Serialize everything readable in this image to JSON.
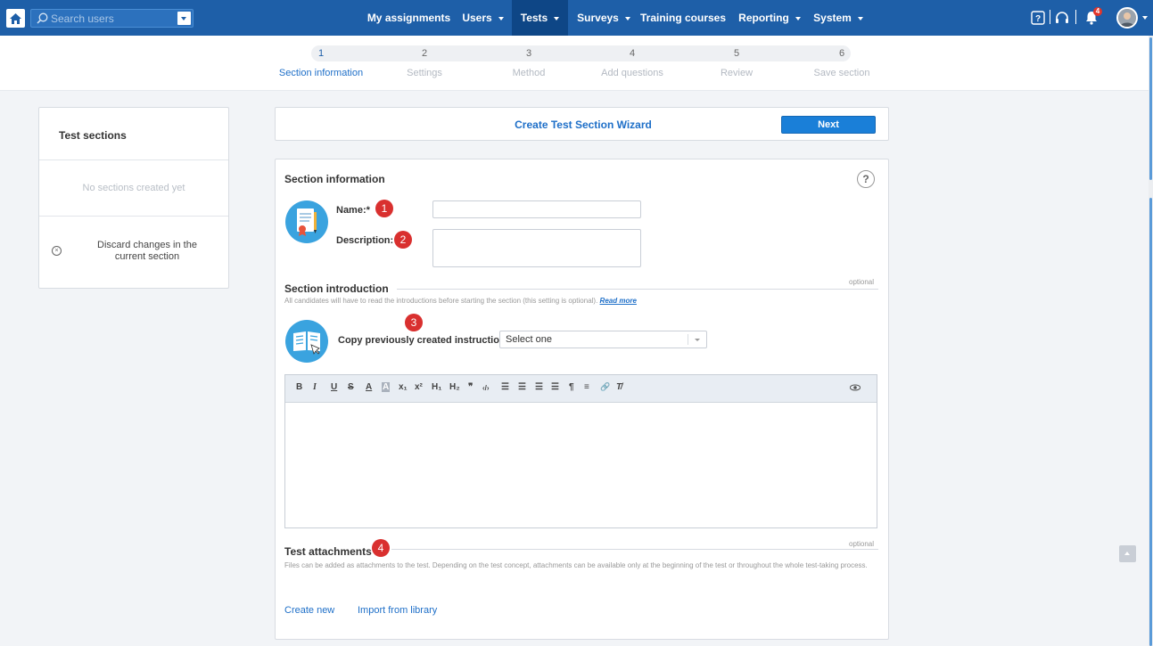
{
  "search": {
    "placeholder": "Search users"
  },
  "nav": {
    "items": [
      {
        "label": "My assignments",
        "dropdown": false
      },
      {
        "label": "Users",
        "dropdown": true
      },
      {
        "label": "Tests",
        "dropdown": true,
        "active": true
      },
      {
        "label": "Surveys",
        "dropdown": true
      },
      {
        "label": "Training courses",
        "dropdown": false
      },
      {
        "label": "Reporting",
        "dropdown": true
      },
      {
        "label": "System",
        "dropdown": true
      }
    ]
  },
  "notifications": {
    "count": "4"
  },
  "steps": [
    {
      "number": "1",
      "label": "Section information",
      "active": true
    },
    {
      "number": "2",
      "label": "Settings"
    },
    {
      "number": "3",
      "label": "Method"
    },
    {
      "number": "4",
      "label": "Add questions"
    },
    {
      "number": "5",
      "label": "Review"
    },
    {
      "number": "6",
      "label": "Save section"
    }
  ],
  "sidebar": {
    "title": "Test sections",
    "empty_text": "No sections created yet",
    "discard_line1": "Discard changes in the",
    "discard_line2": "current section"
  },
  "wizard": {
    "title": "Create Test Section Wizard",
    "next_label": "Next"
  },
  "section_info": {
    "heading": "Section information",
    "help": "?",
    "name_label": "Name:*",
    "name_value": "",
    "description_label": "Description:",
    "description_value": "",
    "badge1": "1",
    "badge2": "2"
  },
  "introduction": {
    "heading": "Section introduction",
    "optional": "optional",
    "note": "All candidates will have to read the introductions before starting the section (this setting is optional).",
    "read_more": "Read more",
    "badge3": "3",
    "copy_label": "Copy previously created instructions:",
    "select_value": "Select one"
  },
  "editor": {
    "tools": [
      "B",
      "I",
      "U",
      "S",
      "A",
      "A",
      "x₁",
      "x²",
      "H₁",
      "H₂",
      "❞",
      "‹/›",
      "☰",
      "☰",
      "☰",
      "☰",
      "¶",
      "≡",
      "🔗",
      "T̸"
    ]
  },
  "attachments": {
    "heading": "Test attachments",
    "badge4": "4",
    "optional": "optional",
    "text": "Files can be added as attachments to the test. Depending on the test concept, attachments can be available only at the beginning of the test or throughout the whole test-taking process.",
    "create_new": "Create new",
    "import_library": "Import from library"
  },
  "colors": {
    "topbar": "#1e5fa8",
    "active_nav": "#0e4686",
    "accent": "#1e6fc8",
    "badge": "#d9302f"
  }
}
